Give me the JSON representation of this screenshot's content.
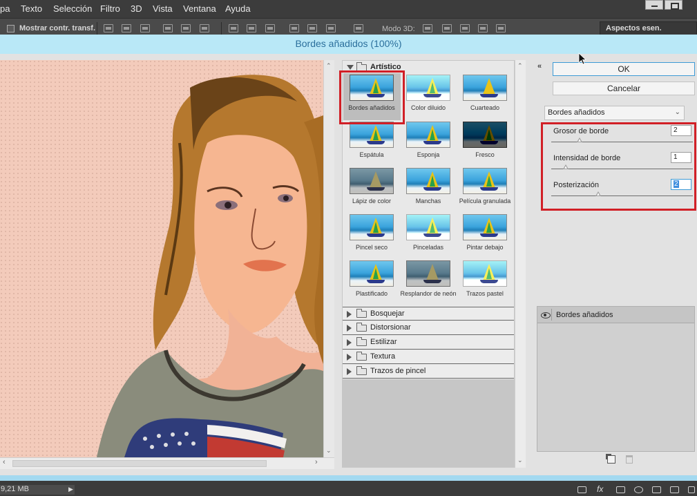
{
  "menu": {
    "items": [
      "pa",
      "Texto",
      "Selección",
      "Filtro",
      "3D",
      "Vista",
      "Ventana",
      "Ayuda"
    ]
  },
  "options_bar": {
    "show_transform_label": "Mostrar contr. transf.",
    "mode3d_label": "Modo 3D:",
    "workspace": "Aspectos esen."
  },
  "dialog": {
    "title": "Bordes añadidos (100%)"
  },
  "gallery": {
    "open_category": "Artístico",
    "filters": [
      {
        "label": "Bordes añadidos"
      },
      {
        "label": "Color diluido"
      },
      {
        "label": "Cuarteado"
      },
      {
        "label": "Espátula"
      },
      {
        "label": "Esponja"
      },
      {
        "label": "Fresco"
      },
      {
        "label": "Lápiz de color"
      },
      {
        "label": "Manchas"
      },
      {
        "label": "Película granulada"
      },
      {
        "label": "Pincel seco"
      },
      {
        "label": "Pinceladas"
      },
      {
        "label": "Pintar debajo"
      },
      {
        "label": "Plastificado"
      },
      {
        "label": "Resplandor de neón"
      },
      {
        "label": "Trazos pastel"
      }
    ],
    "categories": [
      "Bosquejar",
      "Distorsionar",
      "Estilizar",
      "Textura",
      "Trazos de pincel"
    ]
  },
  "actions": {
    "ok": "OK",
    "cancel": "Cancelar"
  },
  "filter_select": {
    "value": "Bordes añadidos"
  },
  "params": [
    {
      "label": "Grosor de borde",
      "value": "2",
      "level": 0.2
    },
    {
      "label": "Intensidad de borde",
      "value": "1",
      "level": 0.1
    },
    {
      "label": "Posterización",
      "value": "2",
      "level": 0.33
    }
  ],
  "layers": {
    "items": [
      {
        "name": "Bordes añadidos"
      }
    ]
  },
  "status": {
    "doc_size": "9,21 MB"
  },
  "colors": {
    "accent_red": "#d11f26",
    "title_blue": "#b9e8f7",
    "focus_blue": "#3c9ad6"
  }
}
